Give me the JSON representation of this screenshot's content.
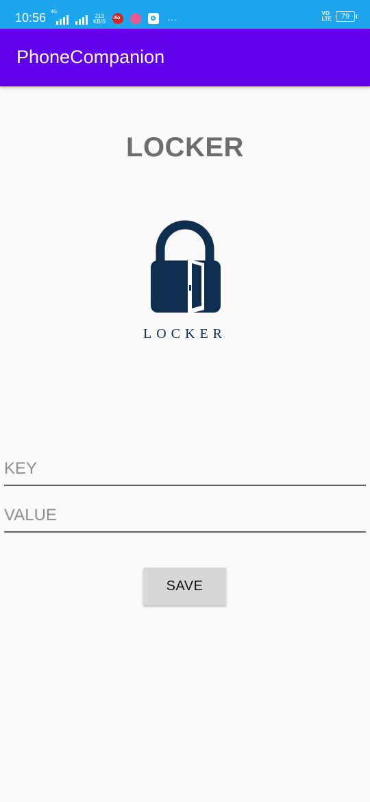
{
  "status_bar": {
    "time": "10:56",
    "network_tag": "4G",
    "speed_value": "213",
    "speed_unit": "KB/S",
    "volte_top": "VO",
    "volte_bottom": "LTE",
    "battery": "79",
    "background_color": "#1da5ee",
    "icons": [
      "signal-icon",
      "jio-app-icon",
      "app-notification-icon",
      "telegram-icon",
      "more-dots-icon",
      "battery-icon"
    ]
  },
  "app_bar": {
    "title": "PhoneCompanion",
    "background_color": "#6200ee"
  },
  "main": {
    "heading": "LOCKER",
    "logo_text": "LOCKER",
    "logo_color": "#0e2e4f",
    "key_field": {
      "placeholder": "KEY",
      "value": ""
    },
    "value_field": {
      "placeholder": "VALUE",
      "value": ""
    },
    "save_button": {
      "label": "SAVE"
    }
  }
}
